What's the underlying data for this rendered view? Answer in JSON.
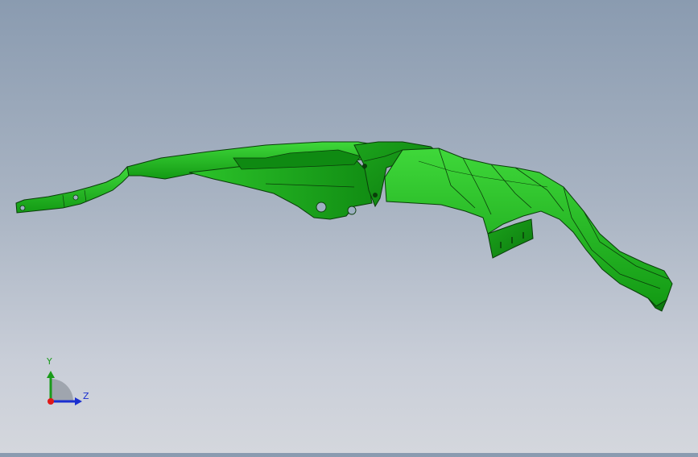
{
  "viewport": {
    "part_color": "#22b522",
    "part_dark": "#0e7d10",
    "part_light": "#3ed83a",
    "edge_color": "#0a3d0a"
  },
  "triad": {
    "y_label": "Y",
    "z_label": "Z",
    "y_color": "#1a9a1a",
    "z_color": "#1a2fd0",
    "x_color": "#e01818"
  }
}
